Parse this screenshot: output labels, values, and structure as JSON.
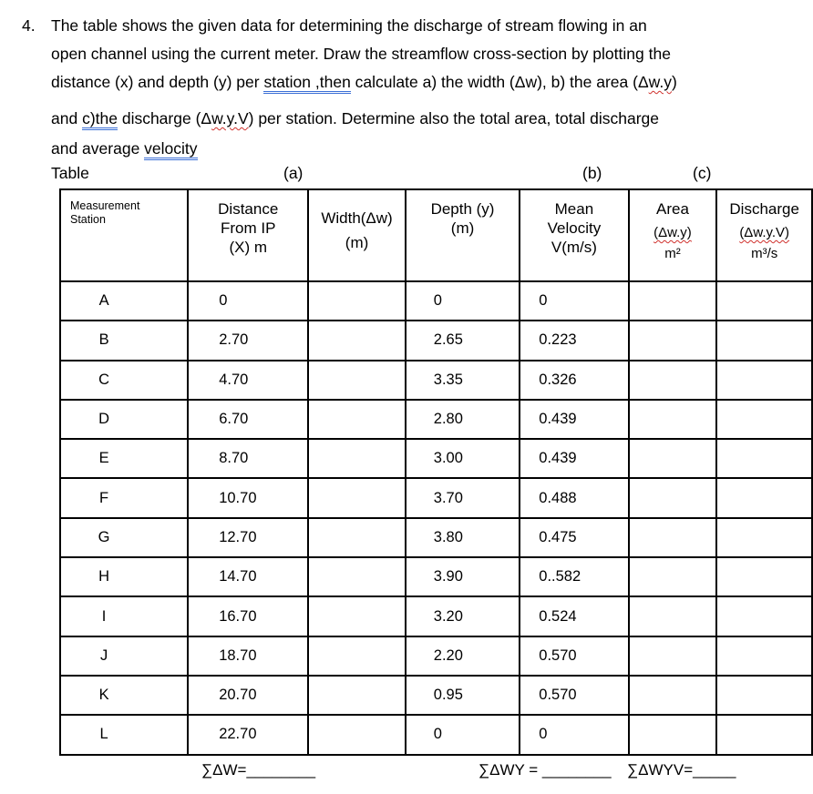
{
  "question": {
    "number": "4.",
    "line1": "The table shows the given data for determining the discharge of stream flowing in an",
    "line2": "open channel using the current meter. Draw the streamflow cross-section by plotting the",
    "line3_a": "distance (x) and depth (y) per ",
    "line3_b": "station ,then",
    "line3_c": " calculate a) the width (Δw), b) the area (Δ",
    "line3_d": "w.y",
    "line3_e": ")",
    "line4_a": "and ",
    "line4_b": "c)the",
    "line4_c": " discharge (Δ",
    "line4_d": "w.y.V",
    "line4_e": ") per station. Determine also the total area, total discharge",
    "line5_a": "and average ",
    "line5_b": "velocity"
  },
  "labels": {
    "table": "Table",
    "a": "(a)",
    "b": "(b)",
    "c": "(c)"
  },
  "table": {
    "headers": {
      "station": [
        "Measurement",
        "Station"
      ],
      "distance": [
        "Distance",
        "From IP",
        "(X) m"
      ],
      "width": [
        "Width(Δw)",
        "(m)"
      ],
      "depth": [
        "Depth (y)",
        "(m)"
      ],
      "velocity": [
        "Mean",
        "Velocity",
        "V(m/s)"
      ],
      "area": [
        "Area",
        "(Δw.y)",
        "m²"
      ],
      "discharge": [
        "Discharge",
        "(Δw.y.V)",
        "m³/s"
      ]
    },
    "rows": [
      {
        "station": "A",
        "distance": "0",
        "width": "",
        "depth": "0",
        "velocity": "0",
        "area": "",
        "discharge": ""
      },
      {
        "station": "B",
        "distance": "2.70",
        "width": "",
        "depth": "2.65",
        "velocity": "0.223",
        "area": "",
        "discharge": ""
      },
      {
        "station": "C",
        "distance": "4.70",
        "width": "",
        "depth": "3.35",
        "velocity": "0.326",
        "area": "",
        "discharge": ""
      },
      {
        "station": "D",
        "distance": "6.70",
        "width": "",
        "depth": "2.80",
        "velocity": "0.439",
        "area": "",
        "discharge": ""
      },
      {
        "station": "E",
        "distance": "8.70",
        "width": "",
        "depth": "3.00",
        "velocity": "0.439",
        "area": "",
        "discharge": ""
      },
      {
        "station": "F",
        "distance": "10.70",
        "width": "",
        "depth": "3.70",
        "velocity": "0.488",
        "area": "",
        "discharge": ""
      },
      {
        "station": "G",
        "distance": "12.70",
        "width": "",
        "depth": "3.80",
        "velocity": "0.475",
        "area": "",
        "discharge": ""
      },
      {
        "station": "H",
        "distance": "14.70",
        "width": "",
        "depth": "3.90",
        "velocity": "0..582",
        "area": "",
        "discharge": ""
      },
      {
        "station": "I",
        "distance": "16.70",
        "width": "",
        "depth": "3.20",
        "velocity": "0.524",
        "area": "",
        "discharge": ""
      },
      {
        "station": "J",
        "distance": "18.70",
        "width": "",
        "depth": "2.20",
        "velocity": "0.570",
        "area": "",
        "discharge": ""
      },
      {
        "station": "K",
        "distance": "20.70",
        "width": "",
        "depth": "0.95",
        "velocity": "0.570",
        "area": "",
        "discharge": ""
      },
      {
        "station": "L",
        "distance": "22.70",
        "width": "",
        "depth": "0",
        "velocity": "0",
        "area": "",
        "discharge": ""
      }
    ]
  },
  "sums": {
    "width": "∑ΔW=________",
    "area": "∑ΔWY = ________",
    "discharge": "∑ΔWYV=_____"
  }
}
